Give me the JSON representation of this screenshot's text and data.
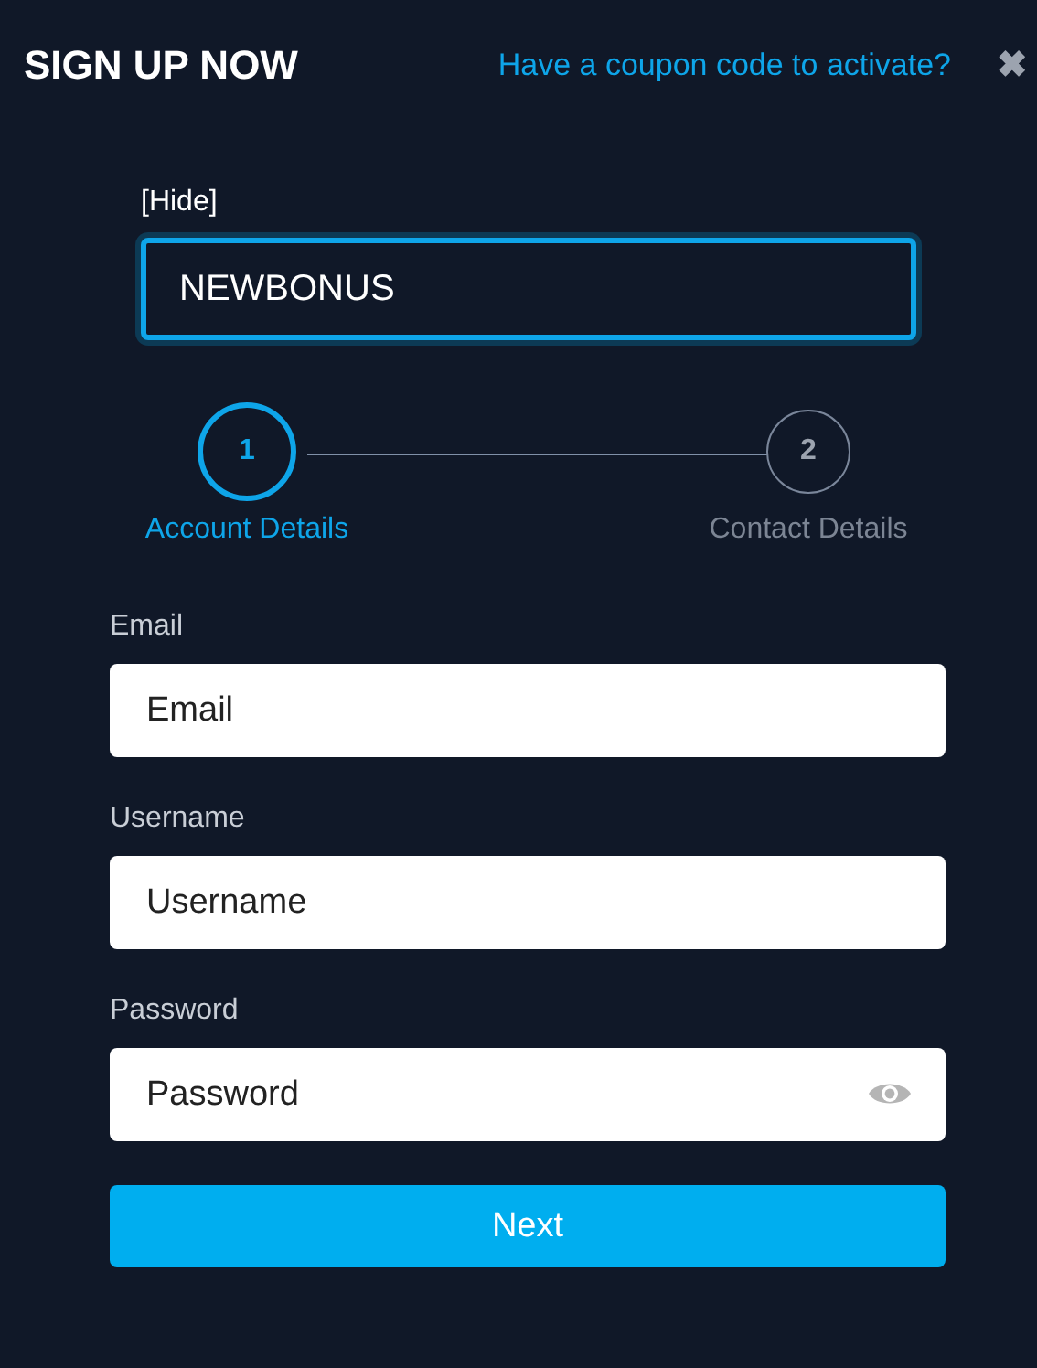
{
  "header": {
    "title": "SIGN UP NOW",
    "coupon_link": "Have a coupon code to activate?",
    "close": "✖"
  },
  "coupon": {
    "toggle": "[Hide]",
    "value": "NEWBONUS"
  },
  "steps": [
    {
      "number": "1",
      "label": "Account Details",
      "selected": true
    },
    {
      "number": "2",
      "label": "Contact Details",
      "selected": false
    }
  ],
  "fields": [
    {
      "label": "Email",
      "placeholder": "Email",
      "kind": "text"
    },
    {
      "label": "Username",
      "placeholder": "Username",
      "kind": "text"
    },
    {
      "label": "Password",
      "placeholder": "Password",
      "kind": "password"
    }
  ],
  "button": "Next"
}
